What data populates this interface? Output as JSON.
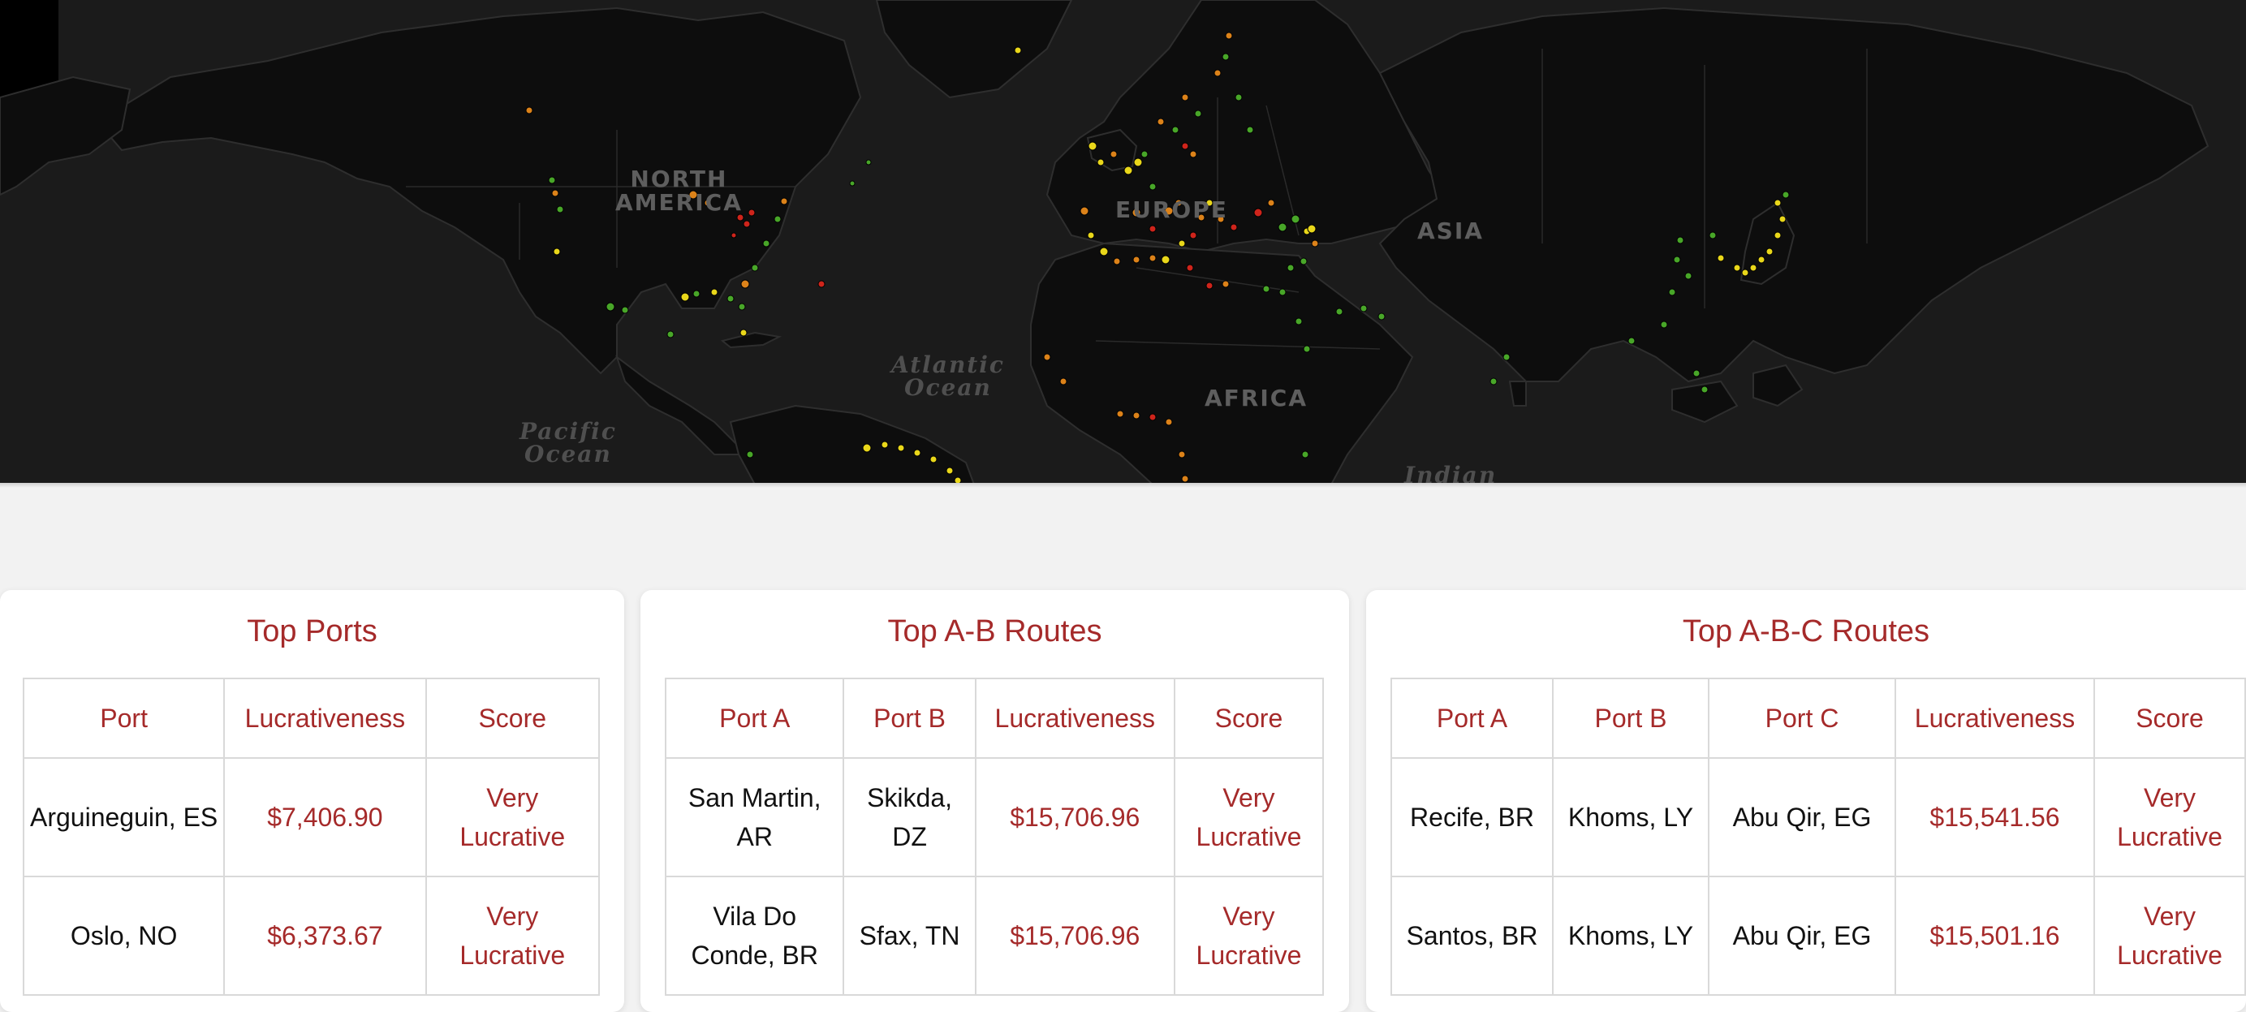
{
  "colors": {
    "accent": "#a52a2a",
    "map_background": "#1b1b1b",
    "dot_green": "#4caf2a",
    "dot_yellow": "#f5e21b",
    "dot_orange": "#e8891a",
    "dot_red": "#d9261c"
  },
  "map": {
    "labels": {
      "north_america": "NORTH\nAMERICA",
      "europe": "EUROPE",
      "asia": "ASIA",
      "africa": "AFRICA",
      "atlantic": "Atlantic\nOcean",
      "pacific": "Pacific\nOcean",
      "indian": "Indian"
    }
  },
  "top_ports": {
    "title": "Top Ports",
    "headers": [
      "Port",
      "Lucrativeness",
      "Score"
    ],
    "rows": [
      [
        "Arguineguin, ES",
        "$7,406.90",
        "Very Lucrative"
      ],
      [
        "Oslo, NO",
        "$6,373.67",
        "Very Lucrative"
      ]
    ]
  },
  "top_ab_routes": {
    "title": "Top A-B Routes",
    "headers": [
      "Port A",
      "Port B",
      "Lucrativeness",
      "Score"
    ],
    "rows": [
      [
        "San Martin, AR",
        "Skikda, DZ",
        "$15,706.96",
        "Very Lucrative"
      ],
      [
        "Vila Do Conde, BR",
        "Sfax, TN",
        "$15,706.96",
        "Very Lucrative"
      ]
    ]
  },
  "top_abc_routes": {
    "title": "Top A-B-C Routes",
    "headers": [
      "Port A",
      "Port B",
      "Port C",
      "Lucrativeness",
      "Score"
    ],
    "rows": [
      [
        "Recife, BR",
        "Khoms, LY",
        "Abu Qir, EG",
        "$15,541.56",
        "Very Lucrative"
      ],
      [
        "Santos, BR",
        "Khoms, LY",
        "Abu Qir, EG",
        "$15,501.16",
        "Very Lucrative"
      ]
    ]
  }
}
